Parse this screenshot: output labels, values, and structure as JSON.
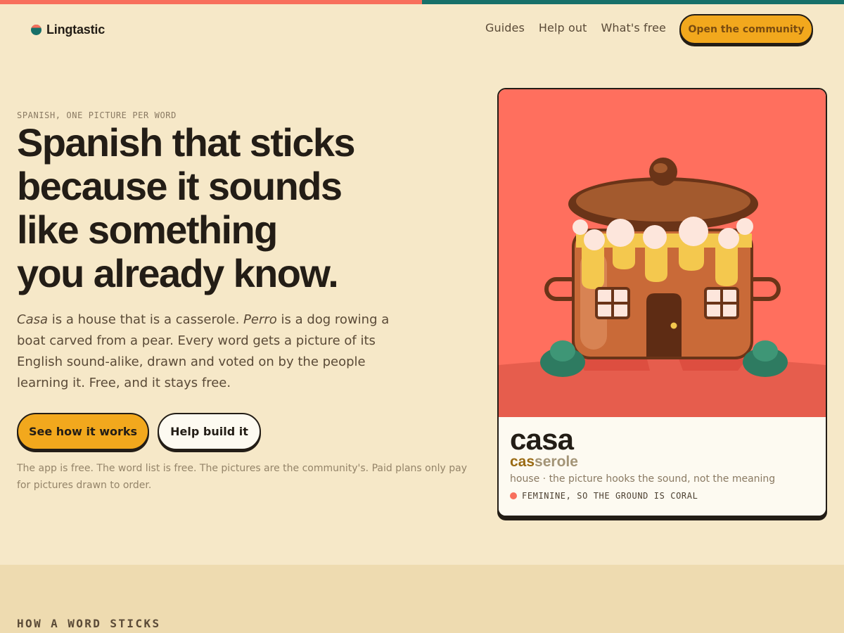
{
  "brand": {
    "name": "Lingtastic",
    "colors": {
      "coral": "#f86f5c",
      "teal": "#177069",
      "amber": "#f2a81d",
      "cream": "#f6e8c8",
      "ink": "#231d16"
    }
  },
  "nav": {
    "links": [
      "Guides",
      "Help out",
      "What's free"
    ],
    "cta": "Open the community"
  },
  "hero": {
    "eyebrow": "SPANISH, ONE PICTURE PER WORD",
    "headline": [
      "Spanish that sticks",
      "because it sounds",
      "like something",
      "you already know."
    ],
    "lede": {
      "word1": "Casa",
      "part1": " is a house that is a casserole. ",
      "word2": "Perro",
      "part2": " is a dog rowing a boat carved from a pear. Every word gets a picture of its English sound-alike, drawn and voted on by the people learning it. Free, and it stays free."
    },
    "primary_button": "See how it works",
    "secondary_button": "Help build it",
    "fineprint": "The app is free. The word list is free. The pictures are the community's. Paid plans only pay for pictures drawn to order."
  },
  "card": {
    "illustration": "house-casserole-pot",
    "word": "casa",
    "sound_highlight": "cas",
    "sound_rest": "serole",
    "meaning": "house · the picture hooks the sound, not the meaning",
    "gender": "FEMININE, SO THE GROUND IS CORAL"
  },
  "section": {
    "title": "HOW A WORD STICKS"
  }
}
